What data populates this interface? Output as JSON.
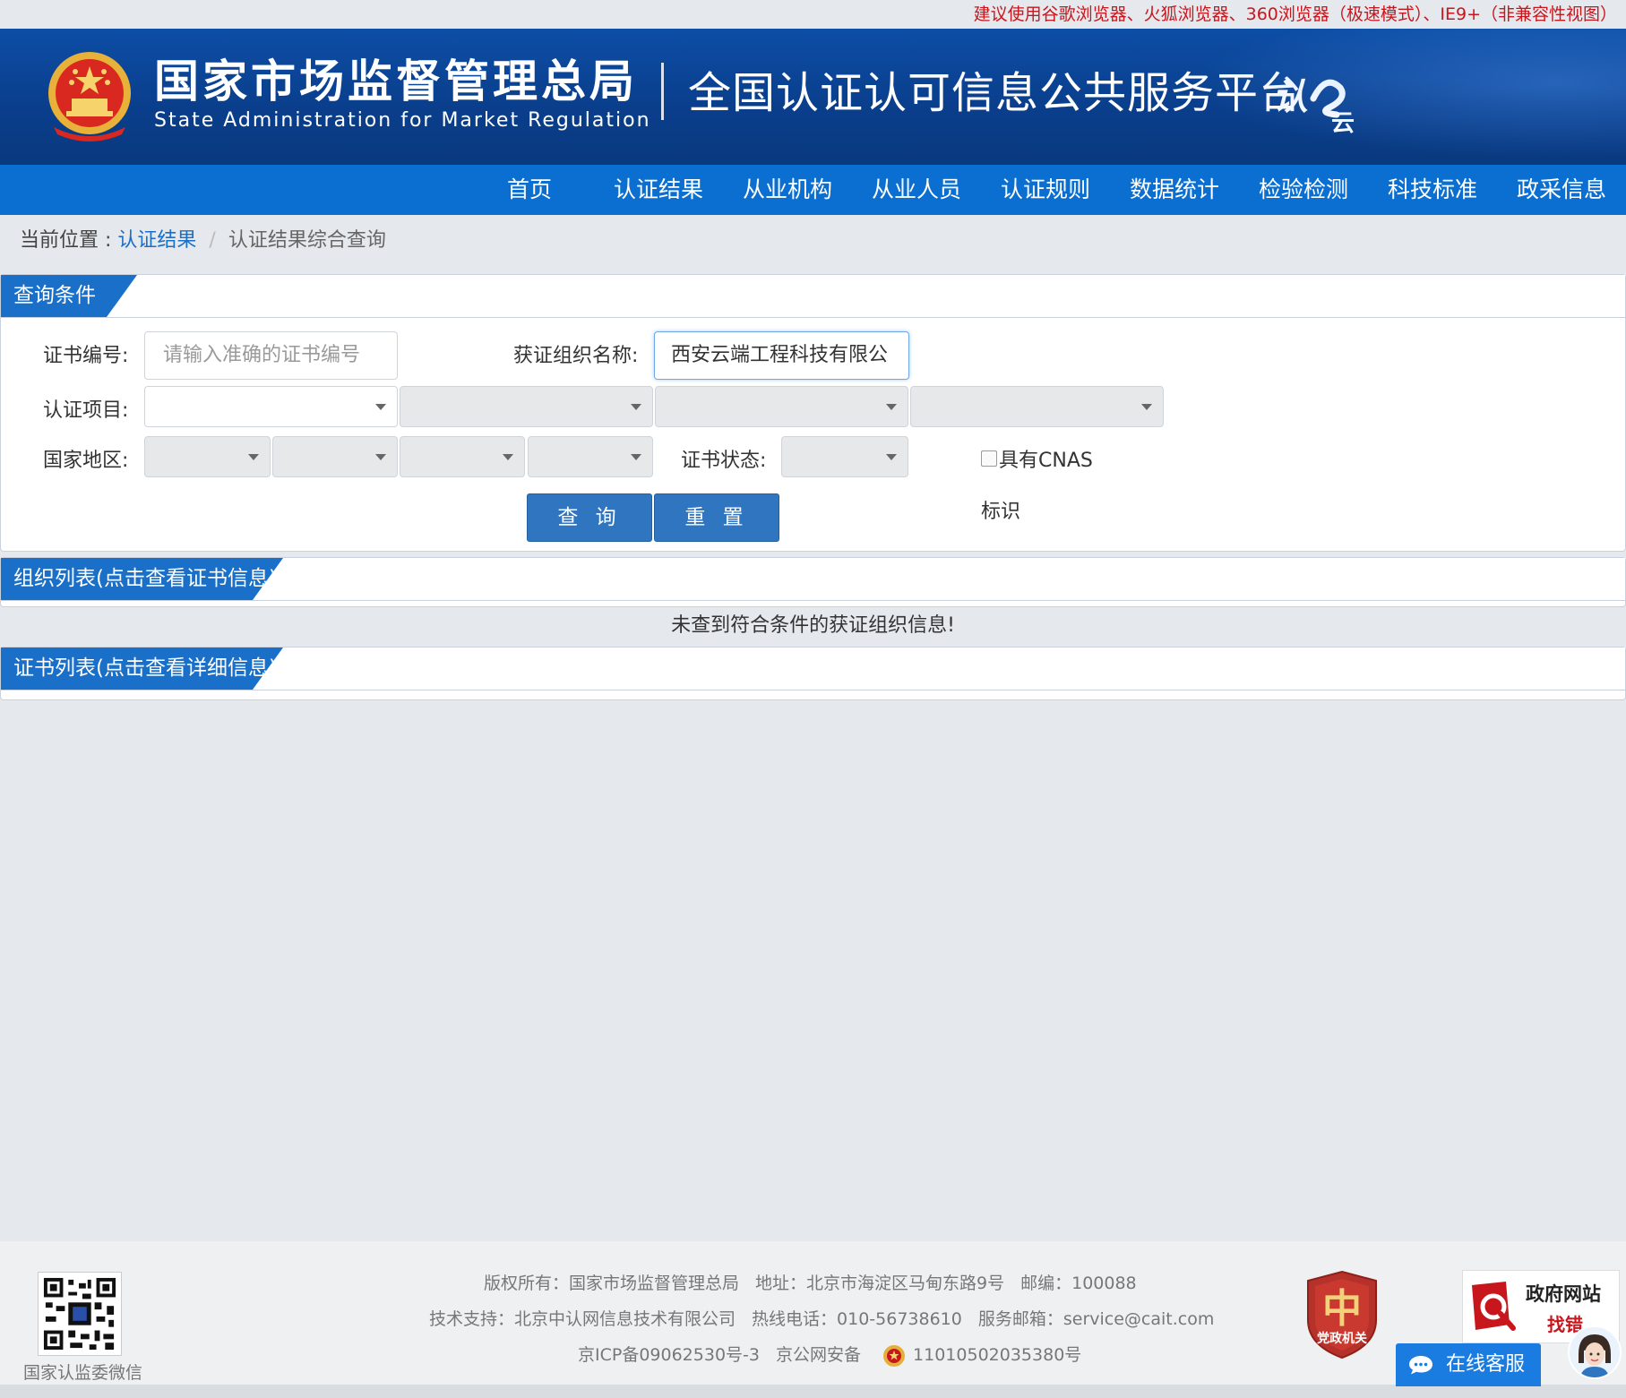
{
  "notice": "建议使用谷歌浏览器、火狐浏览器、360浏览器（极速模式）、IE9+（非兼容性视图）",
  "header": {
    "org_name_cn": "国家市场监督管理总局",
    "org_name_en": "State Administration for Market Regulation",
    "platform_name": "全国认证认可信息公共服务平台",
    "platform_logo_text": "认e云"
  },
  "nav": [
    {
      "label": "首页"
    },
    {
      "label": "认证结果"
    },
    {
      "label": "从业机构"
    },
    {
      "label": "从业人员"
    },
    {
      "label": "认证规则"
    },
    {
      "label": "数据统计"
    },
    {
      "label": "检验检测"
    },
    {
      "label": "科技标准"
    },
    {
      "label": "政采信息"
    }
  ],
  "breadcrumb": {
    "prefix": "当前位置 : ",
    "link": "认证结果",
    "separator": "/",
    "current": "认证结果综合查询"
  },
  "query_panel": {
    "title": "查询条件",
    "cert_no_label": "证书编号:",
    "cert_no_placeholder": "请输入准确的证书编号",
    "org_name_label": "获证组织名称:",
    "org_name_value": "西安云端工程科技有限公",
    "cert_item_label": "认证项目:",
    "region_label": "国家地区:",
    "cert_status_label": "证书状态:",
    "cnas_label_1": "具有CNAS",
    "cnas_label_2": "标识",
    "query_button": "查 询",
    "reset_button": "重 置"
  },
  "org_list": {
    "title": "组织列表(点击查看证书信息)",
    "empty_message": "未查到符合条件的获证组织信息!"
  },
  "cert_list": {
    "title": "证书列表(点击查看详细信息)"
  },
  "footer": {
    "qr_caption": "国家认监委微信",
    "copyright": "版权所有：国家市场监督管理总局",
    "address": "地址：北京市海淀区马甸东路9号",
    "postcode": "邮编：100088",
    "tech_support": "技术支持：北京中认网信息技术有限公司",
    "hotline": "热线电话：010-56738610",
    "email": "服务邮箱：service@cait.com",
    "icp": "京ICP备09062530号-3",
    "police_record_label": "京公网安备",
    "police_record_no": "11010502035380号",
    "party_badge_text": "党政机关",
    "gov_badge_title": "政府网站",
    "gov_badge_sub": "找错",
    "online_service": "在线客服"
  },
  "colors": {
    "header_blue": "#0d4ea6",
    "nav_blue": "#0a6fd0",
    "accent_blue": "#1a6fc8",
    "notice_red": "#c8161d"
  }
}
